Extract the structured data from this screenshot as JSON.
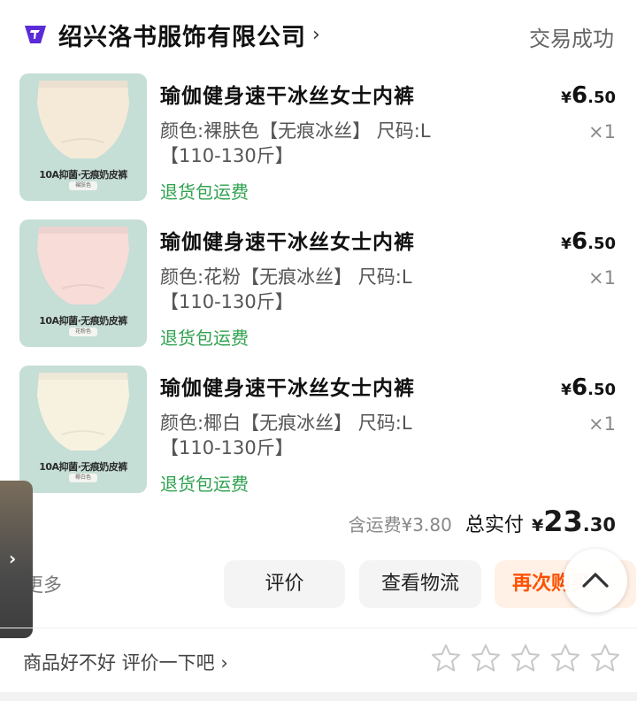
{
  "header": {
    "shop_name": "绍兴洛书服饰有限公司",
    "shop_chevron": "›",
    "order_status": "交易成功",
    "brand_color": "#5b2bd8"
  },
  "items": [
    {
      "title": "瑜伽健身速干冰丝女士内裤",
      "spec_line1": "颜色:裸肤色【无痕冰丝】 尺码:L",
      "spec_line2": "【110-130斤】",
      "return_tag": "退货包运费",
      "price_currency": "¥",
      "price_int": "6",
      "price_dec": ".50",
      "qty": "×1",
      "thumb_caption": "10A抑菌·无痕奶皮裤",
      "thumb_tag": "裸肤色",
      "thumb_color": "#f5ead8"
    },
    {
      "title": "瑜伽健身速干冰丝女士内裤",
      "spec_line1": "颜色:花粉【无痕冰丝】 尺码:L",
      "spec_line2": "【110-130斤】",
      "return_tag": "退货包运费",
      "price_currency": "¥",
      "price_int": "6",
      "price_dec": ".50",
      "qty": "×1",
      "thumb_caption": "10A抑菌·无痕奶皮裤",
      "thumb_tag": "花粉色",
      "thumb_color": "#f7dcd8"
    },
    {
      "title": "瑜伽健身速干冰丝女士内裤",
      "spec_line1": "颜色:椰白【无痕冰丝】 尺码:L",
      "spec_line2": "【110-130斤】",
      "return_tag": "退货包运费",
      "price_currency": "¥",
      "price_int": "6",
      "price_dec": ".50",
      "qty": "×1",
      "thumb_caption": "10A抑菌·无痕奶皮裤",
      "thumb_tag": "椰白色",
      "thumb_color": "#f7f2e0"
    }
  ],
  "total": {
    "shipping": "含运费¥3.80",
    "label": "总实付",
    "currency": "¥",
    "int": "23",
    "dec": ".30"
  },
  "actions": {
    "more": "更多",
    "review": "评价",
    "logistics": "查看物流",
    "rebuy": "再次购买",
    "rebuy_color": "#ff5000"
  },
  "rating": {
    "prompt": "商品好不好 评价一下吧 ›",
    "stars": 5,
    "star_icon": "star-outline-icon"
  },
  "side_tab": {
    "icon": "chevron-right-icon",
    "glyph": "›"
  },
  "scroll_top": {
    "icon": "chevron-up-icon"
  },
  "colors": {
    "green_tag": "#2fa14f",
    "thumb_bg": "#c5ded6"
  }
}
